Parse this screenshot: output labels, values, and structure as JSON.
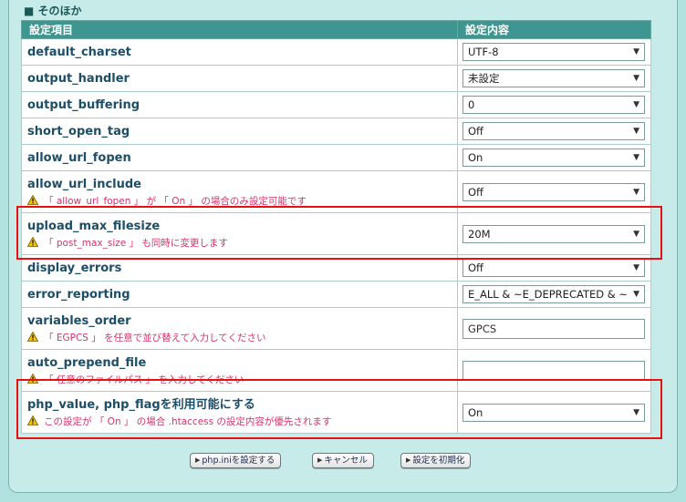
{
  "section": {
    "title": "■ そのほか"
  },
  "table": {
    "headers": [
      "設定項目",
      "設定内容"
    ],
    "rows": [
      {
        "label": "default_charset",
        "type": "select",
        "value": "UTF-8",
        "note": ""
      },
      {
        "label": "output_handler",
        "type": "select",
        "value": "未設定",
        "note": ""
      },
      {
        "label": "output_buffering",
        "type": "select",
        "value": "0",
        "note": ""
      },
      {
        "label": "short_open_tag",
        "type": "select",
        "value": "Off",
        "note": ""
      },
      {
        "label": "allow_url_fopen",
        "type": "select",
        "value": "On",
        "note": ""
      },
      {
        "label": "allow_url_include",
        "type": "select",
        "value": "Off",
        "note": "「 allow_url_fopen 」 が 「 On 」 の場合のみ設定可能です"
      },
      {
        "label": "upload_max_filesize",
        "type": "select",
        "value": "20M",
        "note": "「 post_max_size 」 も同時に変更します"
      },
      {
        "label": "display_errors",
        "type": "select",
        "value": "Off",
        "note": ""
      },
      {
        "label": "error_reporting",
        "type": "select",
        "value": "E_ALL & ~E_DEPRECATED & ~",
        "note": ""
      },
      {
        "label": "variables_order",
        "type": "text",
        "value": "GPCS",
        "note": "「 EGPCS 」 を任意で並び替えて入力してください"
      },
      {
        "label": "auto_prepend_file",
        "type": "text",
        "value": "",
        "note": "「 任意のファイルパス 」 を入力してください"
      },
      {
        "label": "php_value, php_flagを利用可能にする",
        "type": "select",
        "value": "On",
        "note": "この設定が 「 On 」 の場合 .htaccess の設定内容が優先されます"
      }
    ]
  },
  "buttons": {
    "save": "php.iniを設定する",
    "cancel": "キャンセル",
    "reset": "設定を初期化"
  },
  "colors": {
    "header_bg": "#3f9690",
    "label": "#1c4e68",
    "note": "#d6336c",
    "highlight": "#e81010"
  },
  "icons": {
    "warning": "warning-icon",
    "dropdown": "chevron-down-icon",
    "button_arrow": "triangle-right-icon"
  }
}
